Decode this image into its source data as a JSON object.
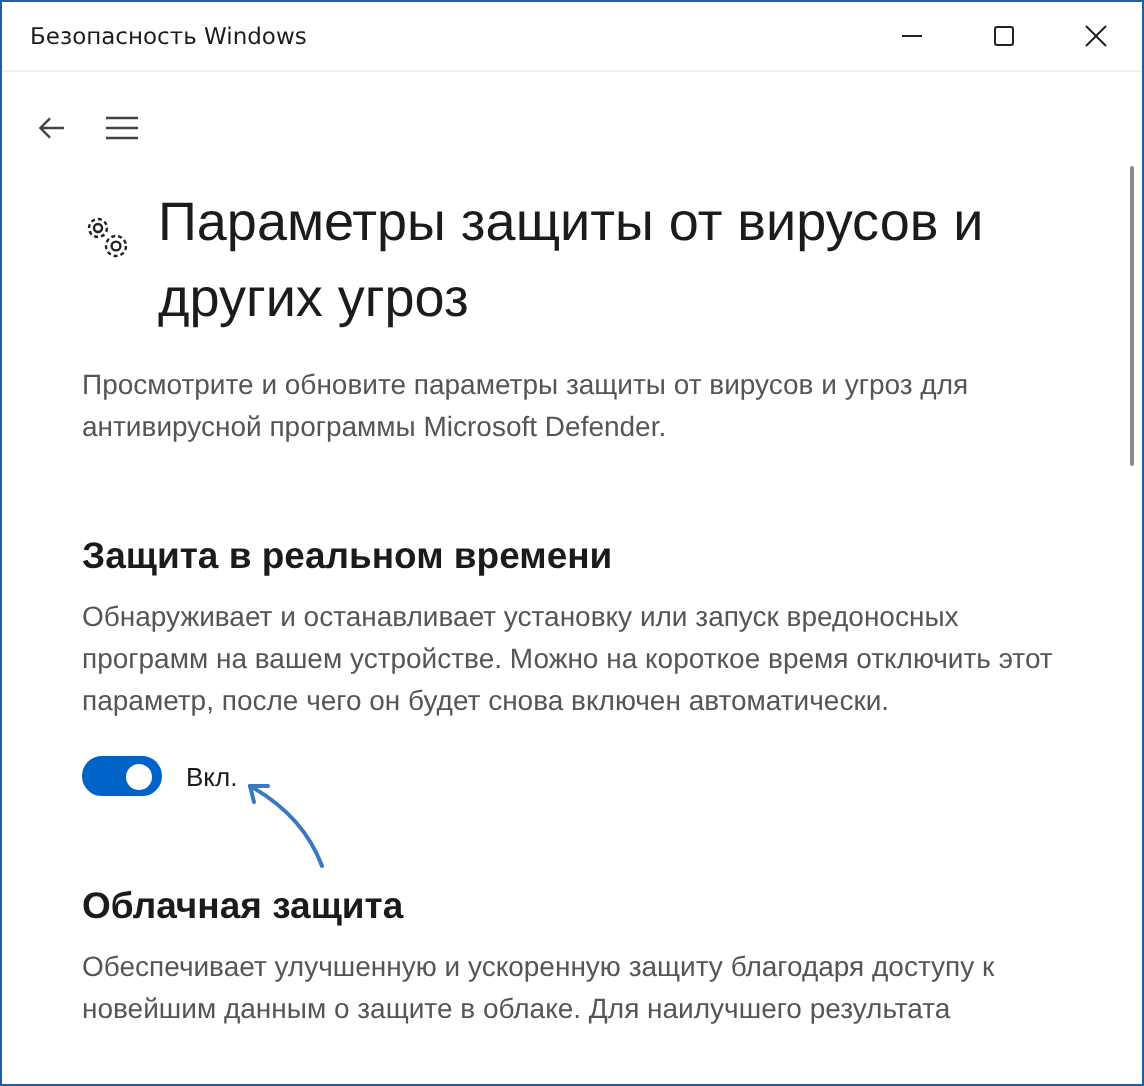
{
  "window": {
    "title": "Безопасность Windows"
  },
  "page": {
    "title": "Параметры защиты от вирусов и других угроз",
    "description": "Просмотрите и обновите параметры защиты от вирусов и угроз для антивирусной программы Microsoft Defender."
  },
  "sections": [
    {
      "kind": "toggle",
      "heading": "Защита в реальном времени",
      "description": "Обнаруживает и останавливает установку или запуск вредоносных программ на вашем устройстве. Можно на короткое время отключить этот параметр, после чего он будет снова включен автоматически.",
      "on": true,
      "state_label": "Вкл."
    },
    {
      "kind": "text",
      "heading": "Облачная защита",
      "description": "Обеспечивает улучшенную и ускоренную защиту благодаря доступу к новейшим данным о защите в облаке. Для наилучшего результата"
    }
  ]
}
